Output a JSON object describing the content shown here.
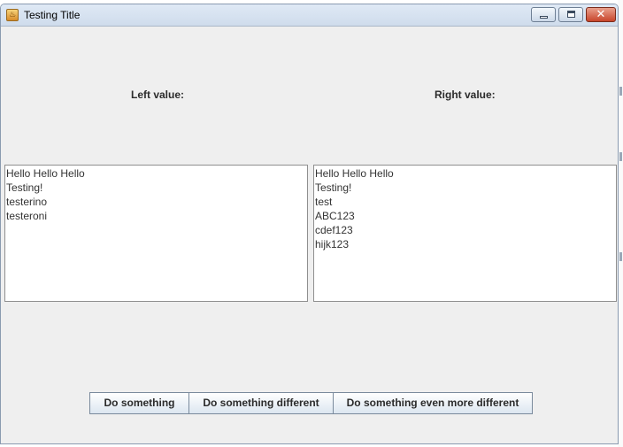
{
  "window": {
    "title": "Testing Title",
    "app_icon": "java-coffee-cup-icon",
    "controls": [
      "minimize-icon",
      "maximize-icon",
      "close-icon"
    ],
    "close_glyph": "✕"
  },
  "labels": {
    "left": "Left value:",
    "right": "Right value:"
  },
  "left_text": {
    "lines": [
      "Hello Hello Hello",
      "Testing!",
      "testerino",
      "testeroni"
    ]
  },
  "right_text": {
    "lines": [
      "Hello Hello Hello",
      "Testing!",
      "test",
      "ABC123",
      "cdef123",
      "hijk123"
    ]
  },
  "buttons": [
    {
      "label": "Do something"
    },
    {
      "label": "Do something different"
    },
    {
      "label": "Do something even more different"
    }
  ]
}
